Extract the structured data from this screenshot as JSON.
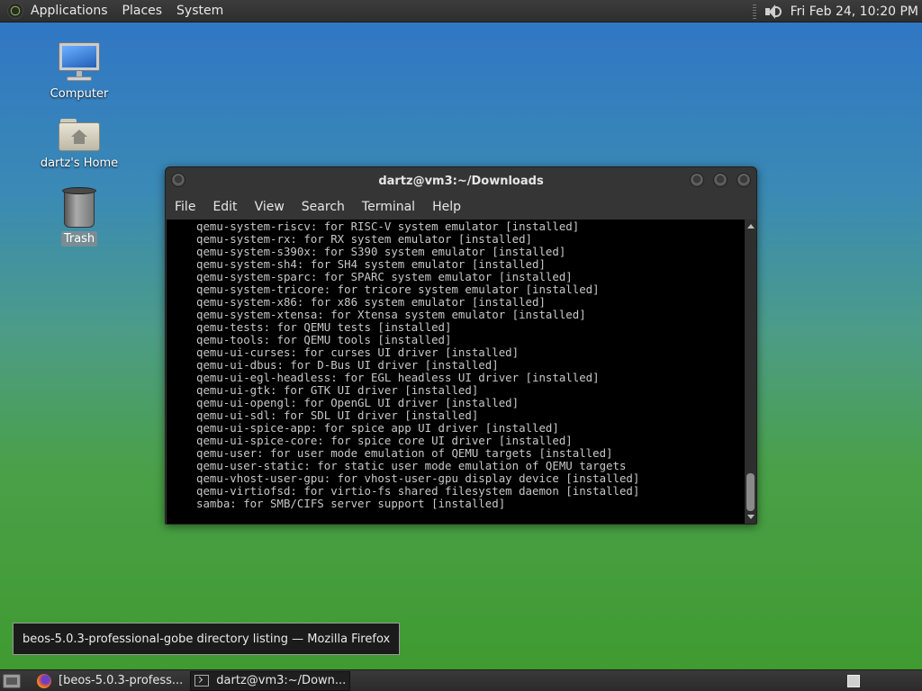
{
  "top_panel": {
    "menu": [
      "Applications",
      "Places",
      "System"
    ],
    "clock": "Fri Feb 24, 10:20 PM",
    "icons": [
      "gnome-foot-icon",
      "volume-icon"
    ]
  },
  "desktop": {
    "icons": [
      {
        "label": "Computer",
        "icon": "computer-icon",
        "selected": false
      },
      {
        "label": "dartz's Home",
        "icon": "home-folder-icon",
        "selected": false
      },
      {
        "label": "Trash",
        "icon": "trash-icon",
        "selected": true
      }
    ]
  },
  "terminal": {
    "title": "dartz@vm3:~/Downloads",
    "menu": [
      "File",
      "Edit",
      "View",
      "Search",
      "Terminal",
      "Help"
    ],
    "lines": [
      "qemu-system-riscv: for RISC-V system emulator [installed]",
      "qemu-system-rx: for RX system emulator [installed]",
      "qemu-system-s390x: for S390 system emulator [installed]",
      "qemu-system-sh4: for SH4 system emulator [installed]",
      "qemu-system-sparc: for SPARC system emulator [installed]",
      "qemu-system-tricore: for tricore system emulator [installed]",
      "qemu-system-x86: for x86 system emulator [installed]",
      "qemu-system-xtensa: for Xtensa system emulator [installed]",
      "qemu-tests: for QEMU tests [installed]",
      "qemu-tools: for QEMU tools [installed]",
      "qemu-ui-curses: for curses UI driver [installed]",
      "qemu-ui-dbus: for D-Bus UI driver [installed]",
      "qemu-ui-egl-headless: for EGL headless UI driver [installed]",
      "qemu-ui-gtk: for GTK UI driver [installed]",
      "qemu-ui-opengl: for OpenGL UI driver [installed]",
      "qemu-ui-sdl: for SDL UI driver [installed]",
      "qemu-ui-spice-app: for spice app UI driver [installed]",
      "qemu-ui-spice-core: for spice core UI driver [installed]",
      "qemu-user: for user mode emulation of QEMU targets [installed]",
      "qemu-user-static: for static user mode emulation of QEMU targets",
      "qemu-vhost-user-gpu: for vhost-user-gpu display device [installed]",
      "qemu-virtiofsd: for virtio-fs shared filesystem daemon [installed]",
      "samba: for SMB/CIFS server support [installed]"
    ]
  },
  "tooltip": "beos-5.0.3-professional-gobe directory listing — Mozilla Firefox",
  "taskbar": {
    "tasks": [
      {
        "label": "[beos-5.0.3-profess...",
        "icon": "firefox-icon",
        "active": false
      },
      {
        "label": "dartz@vm3:~/Down...",
        "icon": "terminal-icon",
        "active": true
      }
    ]
  }
}
